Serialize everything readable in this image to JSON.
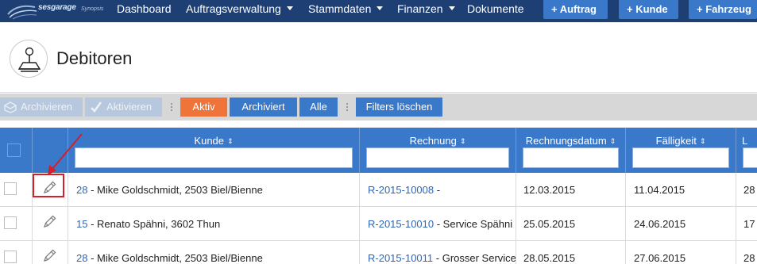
{
  "app": {
    "logo_text": "sesgarage",
    "logo_sub": "Synopsis"
  },
  "nav": {
    "items": [
      {
        "label": "Dashboard"
      },
      {
        "label": "Auftragsverwaltung"
      },
      {
        "label": "Stammdaten"
      },
      {
        "label": "Finanzen"
      },
      {
        "label": "Dokumente"
      }
    ],
    "buttons": [
      {
        "label": "+ Auftrag"
      },
      {
        "label": "+ Kunde"
      },
      {
        "label": "+ Fahrzeug"
      }
    ]
  },
  "page": {
    "title": "Debitoren",
    "icon": "joystick-icon"
  },
  "toolbar": {
    "archive_label": "Archivieren",
    "activate_label": "Aktivieren",
    "filter_active": "Aktiv",
    "filter_archived": "Archiviert",
    "filter_all": "Alle",
    "clear_filters": "Filters löschen"
  },
  "table": {
    "columns": [
      "Kunde",
      "Rechnung",
      "Rechnungsdatum",
      "Fälligkeit",
      "L"
    ],
    "sort_icon": "⇕",
    "rows": [
      {
        "kunde_id": "28",
        "kunde_name": " - Mike Goldschmidt, 2503 Biel/Bienne",
        "rechnung_nr": "R-2015-10008",
        "rechnung_suffix": " -",
        "rechnungsdatum": "12.03.2015",
        "faelligkeit": "11.04.2015",
        "last": "28"
      },
      {
        "kunde_id": "15",
        "kunde_name": " - Renato Spähni, 3602 Thun",
        "rechnung_nr": "R-2015-10010",
        "rechnung_suffix": " - Service Spähni",
        "rechnungsdatum": "25.05.2015",
        "faelligkeit": "24.06.2015",
        "last": "17"
      },
      {
        "kunde_id": "28",
        "kunde_name": " - Mike Goldschmidt, 2503 Biel/Bienne",
        "rechnung_nr": "R-2015-10011",
        "rechnung_suffix": " - Grosser Service",
        "rechnungsdatum": "28.05.2015",
        "faelligkeit": "27.06.2015",
        "last": "28"
      }
    ]
  },
  "colors": {
    "nav_bg": "#1d3f73",
    "accent_blue": "#3a78c9",
    "active_orange": "#f0743a",
    "annotation_red": "#d21f2a",
    "link": "#2f66b3"
  }
}
